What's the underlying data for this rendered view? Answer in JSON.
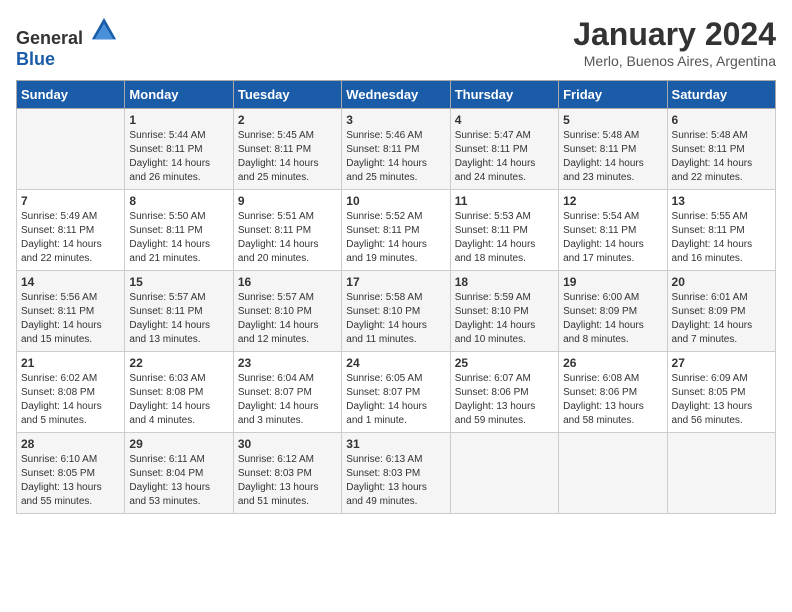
{
  "header": {
    "logo_general": "General",
    "logo_blue": "Blue",
    "month_year": "January 2024",
    "location": "Merlo, Buenos Aires, Argentina"
  },
  "weekdays": [
    "Sunday",
    "Monday",
    "Tuesday",
    "Wednesday",
    "Thursday",
    "Friday",
    "Saturday"
  ],
  "weeks": [
    [
      {
        "day": "",
        "sunrise": "",
        "sunset": "",
        "daylight": ""
      },
      {
        "day": "1",
        "sunrise": "Sunrise: 5:44 AM",
        "sunset": "Sunset: 8:11 PM",
        "daylight": "Daylight: 14 hours and 26 minutes."
      },
      {
        "day": "2",
        "sunrise": "Sunrise: 5:45 AM",
        "sunset": "Sunset: 8:11 PM",
        "daylight": "Daylight: 14 hours and 25 minutes."
      },
      {
        "day": "3",
        "sunrise": "Sunrise: 5:46 AM",
        "sunset": "Sunset: 8:11 PM",
        "daylight": "Daylight: 14 hours and 25 minutes."
      },
      {
        "day": "4",
        "sunrise": "Sunrise: 5:47 AM",
        "sunset": "Sunset: 8:11 PM",
        "daylight": "Daylight: 14 hours and 24 minutes."
      },
      {
        "day": "5",
        "sunrise": "Sunrise: 5:48 AM",
        "sunset": "Sunset: 8:11 PM",
        "daylight": "Daylight: 14 hours and 23 minutes."
      },
      {
        "day": "6",
        "sunrise": "Sunrise: 5:48 AM",
        "sunset": "Sunset: 8:11 PM",
        "daylight": "Daylight: 14 hours and 22 minutes."
      }
    ],
    [
      {
        "day": "7",
        "sunrise": "Sunrise: 5:49 AM",
        "sunset": "Sunset: 8:11 PM",
        "daylight": "Daylight: 14 hours and 22 minutes."
      },
      {
        "day": "8",
        "sunrise": "Sunrise: 5:50 AM",
        "sunset": "Sunset: 8:11 PM",
        "daylight": "Daylight: 14 hours and 21 minutes."
      },
      {
        "day": "9",
        "sunrise": "Sunrise: 5:51 AM",
        "sunset": "Sunset: 8:11 PM",
        "daylight": "Daylight: 14 hours and 20 minutes."
      },
      {
        "day": "10",
        "sunrise": "Sunrise: 5:52 AM",
        "sunset": "Sunset: 8:11 PM",
        "daylight": "Daylight: 14 hours and 19 minutes."
      },
      {
        "day": "11",
        "sunrise": "Sunrise: 5:53 AM",
        "sunset": "Sunset: 8:11 PM",
        "daylight": "Daylight: 14 hours and 18 minutes."
      },
      {
        "day": "12",
        "sunrise": "Sunrise: 5:54 AM",
        "sunset": "Sunset: 8:11 PM",
        "daylight": "Daylight: 14 hours and 17 minutes."
      },
      {
        "day": "13",
        "sunrise": "Sunrise: 5:55 AM",
        "sunset": "Sunset: 8:11 PM",
        "daylight": "Daylight: 14 hours and 16 minutes."
      }
    ],
    [
      {
        "day": "14",
        "sunrise": "Sunrise: 5:56 AM",
        "sunset": "Sunset: 8:11 PM",
        "daylight": "Daylight: 14 hours and 15 minutes."
      },
      {
        "day": "15",
        "sunrise": "Sunrise: 5:57 AM",
        "sunset": "Sunset: 8:11 PM",
        "daylight": "Daylight: 14 hours and 13 minutes."
      },
      {
        "day": "16",
        "sunrise": "Sunrise: 5:57 AM",
        "sunset": "Sunset: 8:10 PM",
        "daylight": "Daylight: 14 hours and 12 minutes."
      },
      {
        "day": "17",
        "sunrise": "Sunrise: 5:58 AM",
        "sunset": "Sunset: 8:10 PM",
        "daylight": "Daylight: 14 hours and 11 minutes."
      },
      {
        "day": "18",
        "sunrise": "Sunrise: 5:59 AM",
        "sunset": "Sunset: 8:10 PM",
        "daylight": "Daylight: 14 hours and 10 minutes."
      },
      {
        "day": "19",
        "sunrise": "Sunrise: 6:00 AM",
        "sunset": "Sunset: 8:09 PM",
        "daylight": "Daylight: 14 hours and 8 minutes."
      },
      {
        "day": "20",
        "sunrise": "Sunrise: 6:01 AM",
        "sunset": "Sunset: 8:09 PM",
        "daylight": "Daylight: 14 hours and 7 minutes."
      }
    ],
    [
      {
        "day": "21",
        "sunrise": "Sunrise: 6:02 AM",
        "sunset": "Sunset: 8:08 PM",
        "daylight": "Daylight: 14 hours and 5 minutes."
      },
      {
        "day": "22",
        "sunrise": "Sunrise: 6:03 AM",
        "sunset": "Sunset: 8:08 PM",
        "daylight": "Daylight: 14 hours and 4 minutes."
      },
      {
        "day": "23",
        "sunrise": "Sunrise: 6:04 AM",
        "sunset": "Sunset: 8:07 PM",
        "daylight": "Daylight: 14 hours and 3 minutes."
      },
      {
        "day": "24",
        "sunrise": "Sunrise: 6:05 AM",
        "sunset": "Sunset: 8:07 PM",
        "daylight": "Daylight: 14 hours and 1 minute."
      },
      {
        "day": "25",
        "sunrise": "Sunrise: 6:07 AM",
        "sunset": "Sunset: 8:06 PM",
        "daylight": "Daylight: 13 hours and 59 minutes."
      },
      {
        "day": "26",
        "sunrise": "Sunrise: 6:08 AM",
        "sunset": "Sunset: 8:06 PM",
        "daylight": "Daylight: 13 hours and 58 minutes."
      },
      {
        "day": "27",
        "sunrise": "Sunrise: 6:09 AM",
        "sunset": "Sunset: 8:05 PM",
        "daylight": "Daylight: 13 hours and 56 minutes."
      }
    ],
    [
      {
        "day": "28",
        "sunrise": "Sunrise: 6:10 AM",
        "sunset": "Sunset: 8:05 PM",
        "daylight": "Daylight: 13 hours and 55 minutes."
      },
      {
        "day": "29",
        "sunrise": "Sunrise: 6:11 AM",
        "sunset": "Sunset: 8:04 PM",
        "daylight": "Daylight: 13 hours and 53 minutes."
      },
      {
        "day": "30",
        "sunrise": "Sunrise: 6:12 AM",
        "sunset": "Sunset: 8:03 PM",
        "daylight": "Daylight: 13 hours and 51 minutes."
      },
      {
        "day": "31",
        "sunrise": "Sunrise: 6:13 AM",
        "sunset": "Sunset: 8:03 PM",
        "daylight": "Daylight: 13 hours and 49 minutes."
      },
      {
        "day": "",
        "sunrise": "",
        "sunset": "",
        "daylight": ""
      },
      {
        "day": "",
        "sunrise": "",
        "sunset": "",
        "daylight": ""
      },
      {
        "day": "",
        "sunrise": "",
        "sunset": "",
        "daylight": ""
      }
    ]
  ]
}
